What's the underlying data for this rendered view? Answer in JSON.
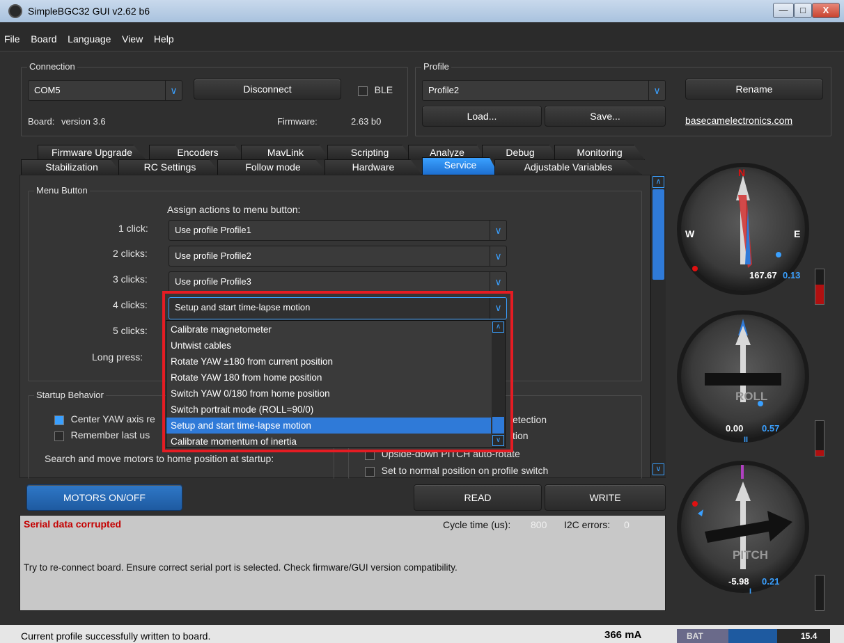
{
  "window": {
    "title": "SimpleBGC32 GUI v2.62 b6",
    "btn_min": "—",
    "btn_max": "□",
    "btn_close": "X"
  },
  "menu": [
    "File",
    "Board",
    "Language",
    "View",
    "Help"
  ],
  "connection": {
    "title": "Connection",
    "port": "COM5",
    "disconnect_label": "Disconnect",
    "ble_label": "BLE",
    "board_label": "Board:",
    "board_value": "version 3.6",
    "firmware_label": "Firmware:",
    "firmware_value": "2.63 b0"
  },
  "profile": {
    "title": "Profile",
    "selected": "Profile2",
    "rename_label": "Rename",
    "load_label": "Load...",
    "save_label": "Save...",
    "link": "basecamelectronics.com"
  },
  "tabs_row1": [
    "Firmware Upgrade",
    "Encoders",
    "MavLink",
    "Scripting",
    "Analyze",
    "Debug",
    "Monitoring"
  ],
  "tabs_row2": [
    "Stabilization",
    "RC Settings",
    "Follow mode",
    "Hardware",
    "Service",
    "Adjustable Variables"
  ],
  "menu_button": {
    "title": "Menu Button",
    "assign_label": "Assign actions to menu button:",
    "rows": [
      {
        "label": "1 click:",
        "value": "Use profile Profile1"
      },
      {
        "label": "2 clicks:",
        "value": "Use profile Profile2"
      },
      {
        "label": "3 clicks:",
        "value": "Use profile Profile3"
      },
      {
        "label": "4 clicks:",
        "value": "Setup and start time-lapse motion"
      },
      {
        "label": "5 clicks:",
        "value": ""
      },
      {
        "label": "Long press:",
        "value": ""
      }
    ]
  },
  "dropdown": {
    "items": [
      "Calibrate magnetometer",
      "Untwist cables",
      "Rotate YAW ±180 from current position",
      "Rotate YAW 180 from home position",
      "Switch YAW 0/180 from home position",
      "Switch portrait mode (ROLL=90/0)",
      "Setup and start time-lapse motion",
      "Calibrate momentum of inertia"
    ],
    "selected_index": 6
  },
  "startup": {
    "title": "Startup Behavior",
    "center_yaw": "Center YAW axis re",
    "remember": "Remember last us",
    "search_label": "Search and move motors to home position at startup:",
    "right_1": "etection",
    "right_2": "tion",
    "right_3": "Upside-down PITCH auto-rotate",
    "right_4": "Set to normal position on profile switch"
  },
  "buttons": {
    "motors": "MOTORS ON/OFF",
    "read": "READ",
    "write": "WRITE"
  },
  "status": {
    "error": "Serial data corrupted",
    "cycle_label": "Cycle time (us):",
    "cycle_value": "800",
    "i2c_label": "I2C errors:",
    "i2c_value": "0",
    "message": "Try to re-connect board. Ensure correct serial port is selected. Check firmware/GUI version compatibility."
  },
  "footer": {
    "message": "Current profile successfully written to board.",
    "current": "366 mA",
    "bat_label": "BAT",
    "bat_value": "15.4"
  },
  "gauges": {
    "yaw": {
      "w": "W",
      "e": "E",
      "n": "N",
      "angle": "167.67",
      "rate": "0.13"
    },
    "roll": {
      "label": "ROLL",
      "angle": "0.00",
      "rate": "0.57",
      "marker": "II"
    },
    "pitch": {
      "label": "PITCH",
      "angle": "-5.98",
      "rate": "0.21",
      "marker": "I"
    }
  },
  "colors": {
    "accent": "#3aa0ff",
    "error": "#c40000",
    "highlight": "#e51c23",
    "battery_red": "#b01010"
  }
}
